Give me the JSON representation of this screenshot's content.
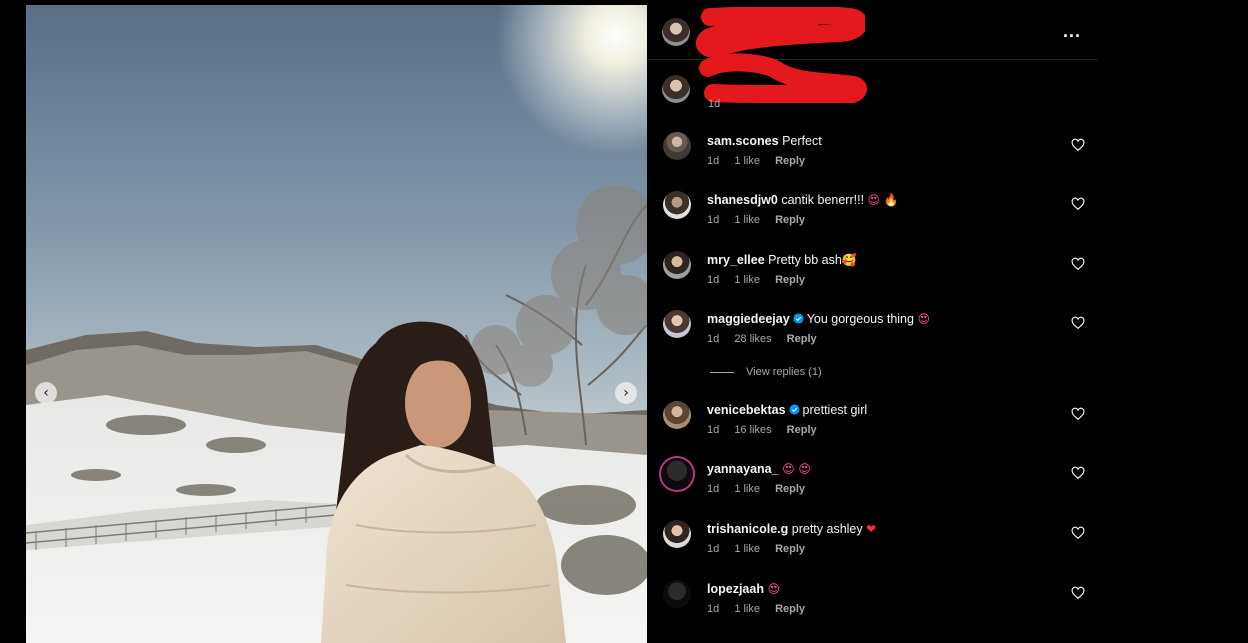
{
  "post": {
    "image_alt": "",
    "nav_prev_icon": "chevron-left-icon",
    "nav_next_icon": "chevron-right-icon",
    "prev_glyph": "‹",
    "next_glyph": "›"
  },
  "header": {
    "more_label": "..."
  },
  "caption": {
    "time": "1d"
  },
  "comments": [
    {
      "user": "sam.scones",
      "verified": false,
      "text": "Perfect",
      "emoji": "",
      "emoji_class": "",
      "time": "1d",
      "likes": "1 like",
      "reply": "Reply"
    },
    {
      "user": "shanesdjw0",
      "verified": false,
      "text": "cantik benerr!!!",
      "emoji": "😍 🔥",
      "emoji_class": "heart-eyes",
      "time": "1d",
      "likes": "1 like",
      "reply": "Reply"
    },
    {
      "user": "mry_ellee",
      "verified": false,
      "text": "Pretty bb ash",
      "emoji": "🥰",
      "emoji_class": "heart-eyes",
      "time": "1d",
      "likes": "1 like",
      "reply": "Reply"
    },
    {
      "user": "maggiedeejay",
      "verified": true,
      "text": "You gorgeous thing",
      "emoji": "😍",
      "emoji_class": "heart-eyes",
      "time": "1d",
      "likes": "28 likes",
      "reply": "Reply"
    },
    {
      "user": "venicebektas",
      "verified": true,
      "text": "prettiest girl",
      "emoji": "",
      "emoji_class": "",
      "time": "1d",
      "likes": "16 likes",
      "reply": "Reply"
    },
    {
      "user": "yannayana_",
      "verified": false,
      "text": "",
      "emoji": "😍 😍",
      "emoji_class": "heart-eyes",
      "time": "1d",
      "likes": "1 like",
      "reply": "Reply"
    },
    {
      "user": "trishanicole.g",
      "verified": false,
      "text": "pretty ashley",
      "emoji": "❤",
      "emoji_class": "red",
      "time": "1d",
      "likes": "1 like",
      "reply": "Reply"
    },
    {
      "user": "lopezjaah",
      "verified": false,
      "text": "",
      "emoji": "😍",
      "emoji_class": "heart-eyes",
      "time": "1d",
      "likes": "1 like",
      "reply": "Reply"
    }
  ],
  "view_replies": "View replies (1)",
  "colors": {
    "background": "#000000",
    "text": "#f5f5f5",
    "muted": "#a8a8a8",
    "verified": "#0095f6",
    "redaction": "#e3191e"
  }
}
